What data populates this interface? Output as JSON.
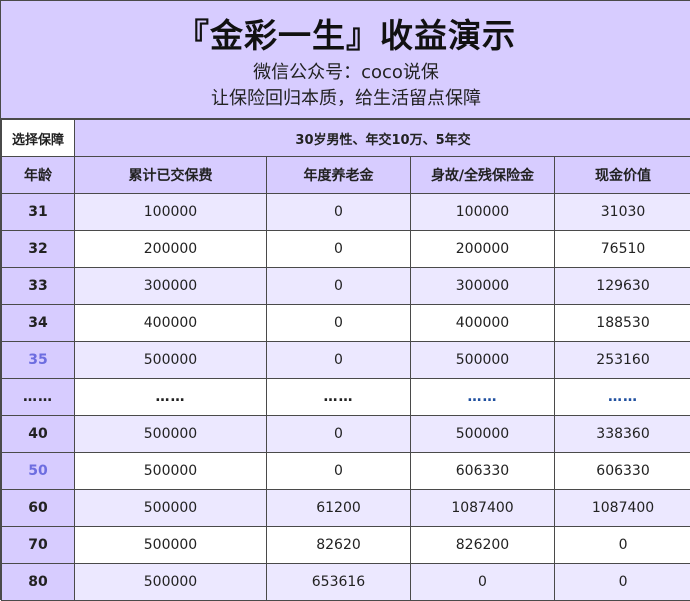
{
  "header": {
    "title": "『金彩一生』收益演示",
    "subtitle1": "微信公众号：coco说保",
    "subtitle2": "让保险回归本质，给生活留点保障"
  },
  "plan": {
    "label": "选择保障",
    "value": "30岁男性、年交10万、5年交"
  },
  "columns": [
    "年龄",
    "累计已交保费",
    "年度养老金",
    "身故/全残保险金",
    "现金价值"
  ],
  "rows": [
    {
      "age": "31",
      "premium": "100000",
      "pension": "0",
      "death": "100000",
      "cash": "31030"
    },
    {
      "age": "32",
      "premium": "200000",
      "pension": "0",
      "death": "200000",
      "cash": "76510"
    },
    {
      "age": "33",
      "premium": "300000",
      "pension": "0",
      "death": "300000",
      "cash": "129630"
    },
    {
      "age": "34",
      "premium": "400000",
      "pension": "0",
      "death": "400000",
      "cash": "188530"
    },
    {
      "age": "35",
      "premium": "500000",
      "pension": "0",
      "death": "500000",
      "cash": "253160"
    },
    {
      "age": "……",
      "premium": "……",
      "pension": "……",
      "death": "……",
      "cash": "……"
    },
    {
      "age": "40",
      "premium": "500000",
      "pension": "0",
      "death": "500000",
      "cash": "338360"
    },
    {
      "age": "50",
      "premium": "500000",
      "pension": "0",
      "death": "606330",
      "cash": "606330"
    },
    {
      "age": "60",
      "premium": "500000",
      "pension": "61200",
      "death": "1087400",
      "cash": "1087400"
    },
    {
      "age": "70",
      "premium": "500000",
      "pension": "82620",
      "death": "826200",
      "cash": "0"
    },
    {
      "age": "80",
      "premium": "500000",
      "pension": "653616",
      "death": "0",
      "cash": "0"
    }
  ],
  "colors": {
    "header_bg": "#d7ccff",
    "row_alt_bg": "#ece8ff",
    "accent_age": "#6d6de0",
    "dots_blue": "#2050a0"
  }
}
